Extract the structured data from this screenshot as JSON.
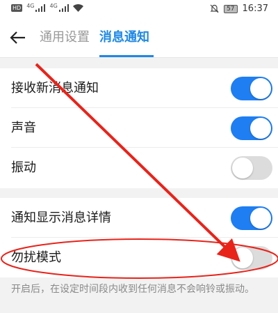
{
  "status_bar": {
    "hd": "HD",
    "sig1": "4G",
    "sig2": "4G",
    "battery": "57",
    "time": "16:37"
  },
  "header": {
    "back_icon": "back-arrow-icon",
    "tabs": [
      {
        "label": "通用设置",
        "active": false
      },
      {
        "label": "消息通知",
        "active": true
      }
    ]
  },
  "settings": {
    "group1": [
      {
        "label": "接收新消息通知",
        "on": true
      },
      {
        "label": "声音",
        "on": true
      },
      {
        "label": "振动",
        "on": false
      }
    ],
    "group2": [
      {
        "label": "通知显示消息详情",
        "on": true
      },
      {
        "label": "勿扰模式",
        "on": false
      }
    ]
  },
  "footnote": "开启后，在设定时间段内收到任何消息不会响铃或振动。",
  "colors": {
    "accent": "#1e88e5",
    "toggle_on": "#1e7ef2",
    "toggle_off": "#dcdcdc",
    "annotation": "#e8231a"
  }
}
